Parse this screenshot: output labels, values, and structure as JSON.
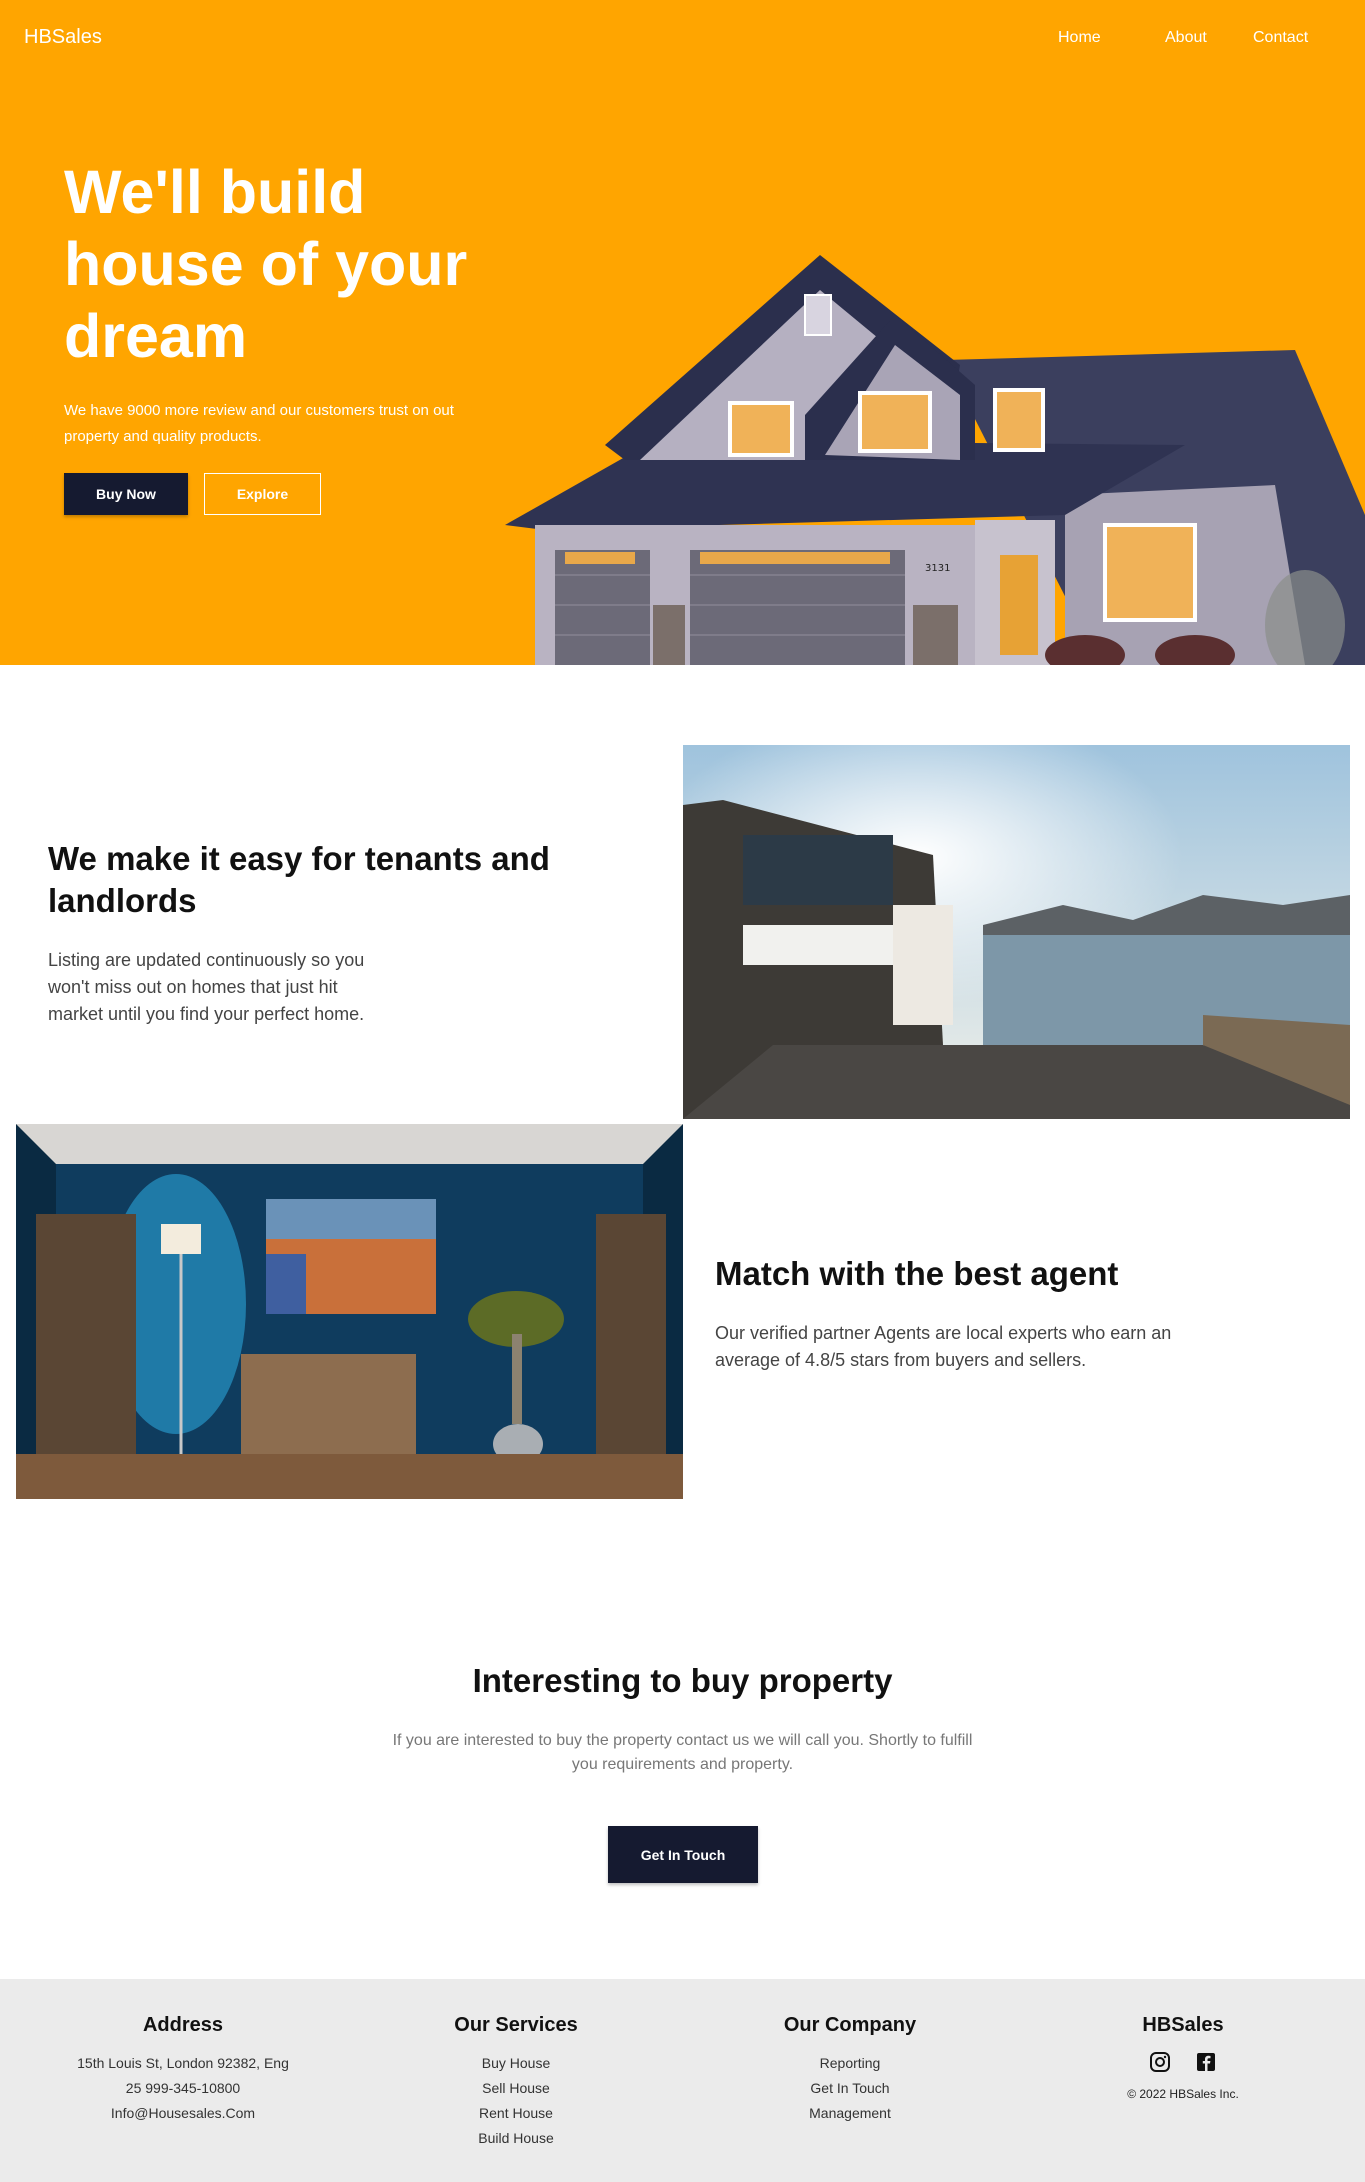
{
  "nav": {
    "brand": "HBSales",
    "links": [
      "Home",
      "About",
      "Contact"
    ]
  },
  "hero": {
    "title": "We'll build house of your dream",
    "subtitle": "We have 9000 more review and our customers trust on out property and quality products.",
    "buy_label": "Buy Now",
    "explore_label": "Explore",
    "house_number": "3131"
  },
  "feature1": {
    "title": "We make it easy for tenants and landlords",
    "text": "Listing are updated continuously so you won't miss out on homes that just hit market until you find your perfect home."
  },
  "feature2": {
    "title": "Match with the best agent",
    "text": "Our verified partner Agents are local experts who earn an average of 4.8/5 stars from buyers and sellers."
  },
  "cta": {
    "title": "Interesting to buy property",
    "text": "If you are interested to buy the property contact us we will call you. Shortly to fulfill you requirements and property.",
    "button_label": "Get In Touch"
  },
  "footer": {
    "address": {
      "heading": "Address",
      "lines": [
        "15th Louis St, London 92382, Eng",
        "25 999-345-10800",
        "Info@Housesales.Com"
      ]
    },
    "services": {
      "heading": "Our Services",
      "lines": [
        "Buy House",
        "Sell House",
        "Rent House",
        "Build House"
      ]
    },
    "company": {
      "heading": "Our Company",
      "lines": [
        "Reporting",
        "Get In Touch",
        "Management"
      ]
    },
    "brand": {
      "heading": "HBSales",
      "icons": [
        "instagram-icon",
        "facebook-icon"
      ],
      "copyright": "© 2022 HBSales Inc."
    }
  },
  "colors": {
    "hero_bg": "#FFA500",
    "button_dark": "#151a30",
    "footer_bg": "#ebebeb"
  }
}
